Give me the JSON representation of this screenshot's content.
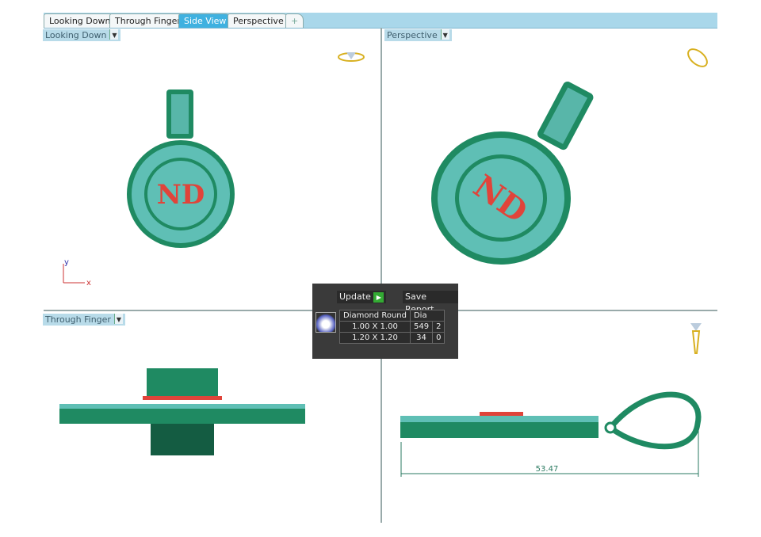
{
  "tabs": [
    {
      "label": "Looking Down"
    },
    {
      "label": "Through Finger"
    },
    {
      "label": "Side View",
      "active": true
    },
    {
      "label": "Perspective"
    },
    {
      "label": "+"
    }
  ],
  "viewports": {
    "top_left": "Looking Down",
    "top_right": "Perspective",
    "bottom_left": "Through Finger"
  },
  "pendant_text": "ND",
  "axes": {
    "x": "x",
    "y": "y"
  },
  "dimension": "53.47",
  "report": {
    "update_label": "Update",
    "save_label": "Save Report",
    "headers": [
      "Diamond Round",
      "Dia"
    ],
    "rows": [
      [
        "1.00 X 1.00",
        "549",
        "2"
      ],
      [
        "1.20 X 1.20",
        "34",
        "0"
      ]
    ]
  },
  "colors": {
    "metal": "#1f8a62",
    "stones": "#7fd3d8",
    "letters": "#e0443a",
    "tab_active": "#3fb1e0"
  }
}
